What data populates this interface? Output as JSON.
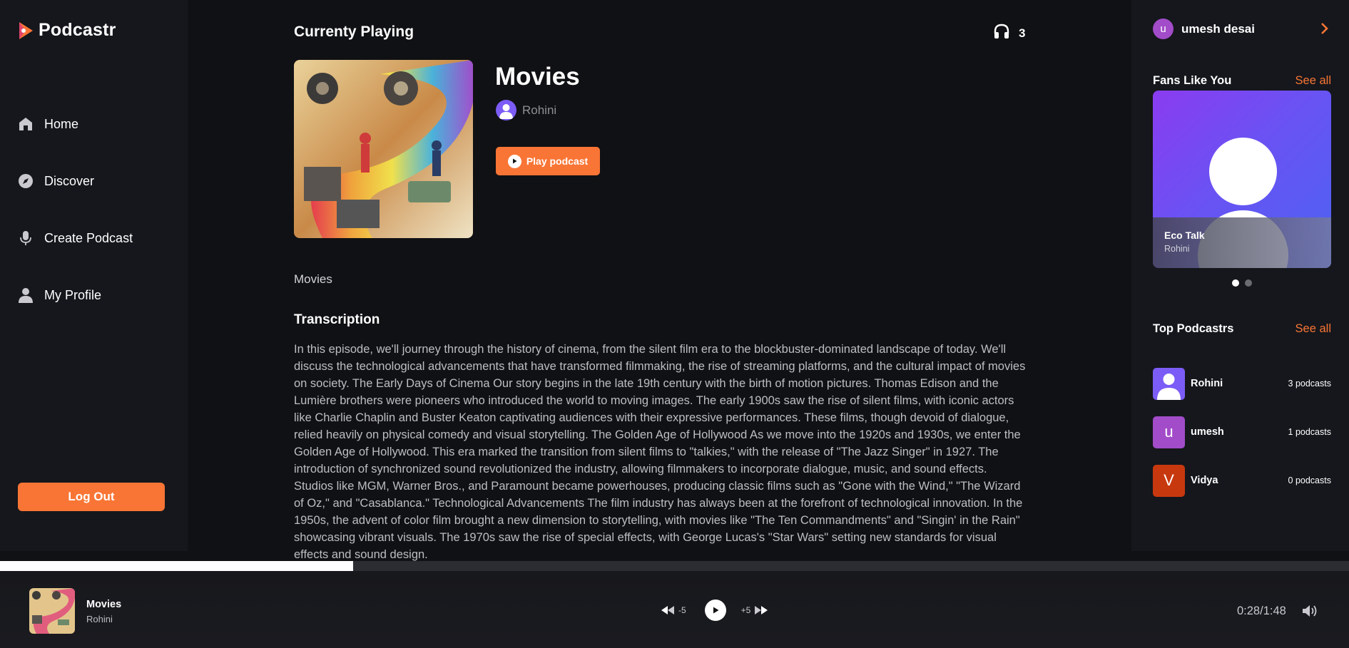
{
  "app": {
    "name": "Podcastr"
  },
  "nav": {
    "items": [
      {
        "label": "Home",
        "icon": "home-icon"
      },
      {
        "label": "Discover",
        "icon": "compass-icon"
      },
      {
        "label": "Create Podcast",
        "icon": "microphone-icon"
      },
      {
        "label": "My Profile",
        "icon": "user-icon"
      }
    ],
    "logout_label": "Log Out"
  },
  "main": {
    "heading": "Currenty Playing",
    "listeners": "3",
    "podcast": {
      "title": "Movies",
      "author": "Rohini",
      "play_label": "Play podcast",
      "description": "Movies"
    },
    "transcription_title": "Transcription",
    "transcription": "In this episode, we'll journey through the history of cinema, from the silent film era to the blockbuster-dominated landscape of today. We'll discuss the technological advancements that have transformed filmmaking, the rise of streaming platforms, and the cultural impact of movies on society. The Early Days of Cinema Our story begins in the late 19th century with the birth of motion pictures. Thomas Edison and the Lumière brothers were pioneers who introduced the world to moving images. The early 1900s saw the rise of silent films, with iconic actors like Charlie Chaplin and Buster Keaton captivating audiences with their expressive performances. These films, though devoid of dialogue, relied heavily on physical comedy and visual storytelling. The Golden Age of Hollywood As we move into the 1920s and 1930s, we enter the Golden Age of Hollywood. This era marked the transition from silent films to \"talkies,\" with the release of \"The Jazz Singer\" in 1927. The introduction of synchronized sound revolutionized the industry, allowing filmmakers to incorporate dialogue, music, and sound effects. Studios like MGM, Warner Bros., and Paramount became powerhouses, producing classic films such as \"Gone with the Wind,\" \"The Wizard of Oz,\" and \"Casablanca.\" Technological Advancements The film industry has always been at the forefront of technological innovation. In the 1950s, the advent of color film brought a new dimension to storytelling, with movies like \"The Ten Commandments\" and \"Singin' in the Rain\" showcasing vibrant visuals. The 1970s saw the rise of special effects, with George Lucas's \"Star Wars\" setting new standards for visual effects and sound design."
  },
  "right": {
    "user": {
      "initial": "u",
      "name": "umesh desai"
    },
    "fans": {
      "title": "Fans Like You",
      "see_all": "See all",
      "card": {
        "title": "Eco Talk",
        "author": "Rohini"
      }
    },
    "top": {
      "title": "Top Podcastrs",
      "see_all": "See all",
      "items": [
        {
          "name": "Rohini",
          "count": "3 podcasts"
        },
        {
          "name": "umesh",
          "initial": "u",
          "count": "1 podcasts"
        },
        {
          "name": "Vidya",
          "initial": "V",
          "count": "0 podcasts"
        }
      ]
    }
  },
  "player": {
    "title": "Movies",
    "author": "Rohini",
    "rewind_label": "-5",
    "forward_label": "+5",
    "time": "0:28/1:48",
    "progress": 0.262
  },
  "colors": {
    "accent": "#f97535",
    "background": "#101114",
    "panel": "#15171c"
  }
}
